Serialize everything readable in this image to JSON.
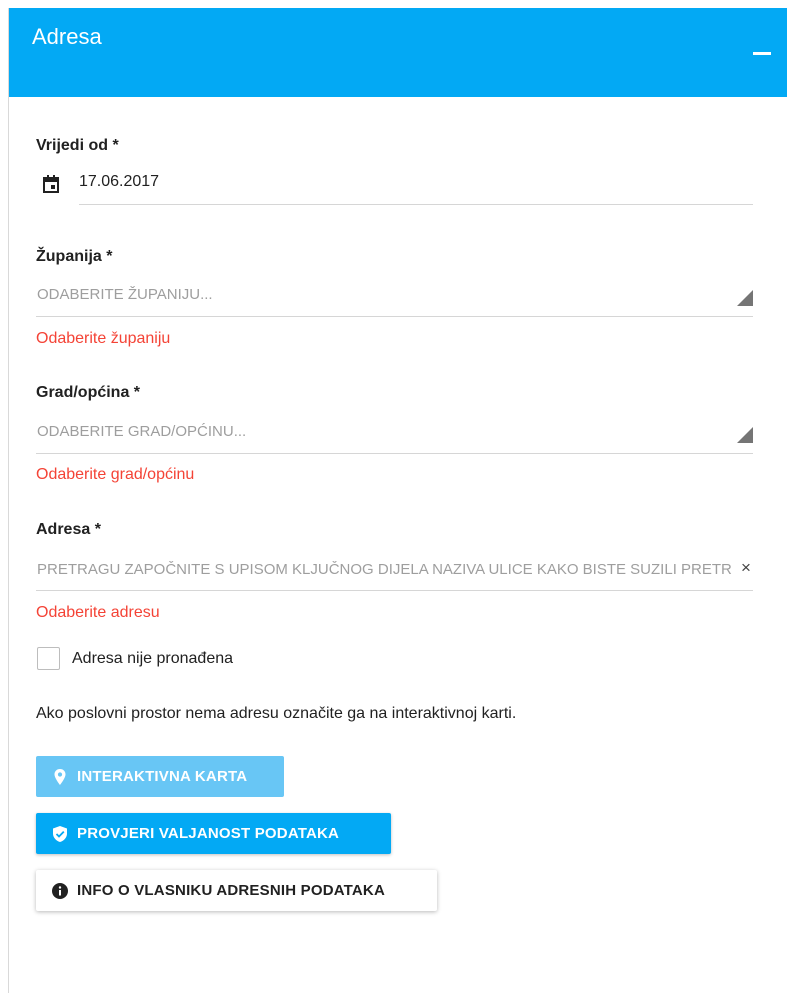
{
  "panel": {
    "title": "Adresa"
  },
  "fields": {
    "valid_from": {
      "label": "Vrijedi od *",
      "value": "17.06.2017"
    },
    "county": {
      "label": "Županija *",
      "placeholder": "ODABERITE ŽUPANIJU...",
      "error": "Odaberite županiju"
    },
    "city": {
      "label": "Grad/općina *",
      "placeholder": "ODABERITE GRAD/OPĆINU...",
      "error": "Odaberite grad/općinu"
    },
    "address": {
      "label": "Adresa *",
      "placeholder": "PRETRAGU ZAPOČNITE S UPISOM KLJUČNOG DIJELA NAZIVA ULICE KAKO BISTE SUZILI PRETRAGU",
      "clear_symbol": "×",
      "error": "Odaberite adresu"
    }
  },
  "address_not_found": {
    "label": "Adresa nije pronađena",
    "checked": false
  },
  "info_text": "Ako poslovni prostor nema adresu označite ga na interaktivnoj karti.",
  "buttons": {
    "map": "INTERAKTIVNA KARTA",
    "validate": "PROVJERI VALJANOST PODATAKA",
    "owner_info": "INFO O VLASNIKU ADRESNIH PODATAKA"
  },
  "colors": {
    "header": "#03a9f4",
    "error": "#f44336",
    "button_primary": "#03a9f4",
    "button_disabled": "#68c6f5"
  }
}
